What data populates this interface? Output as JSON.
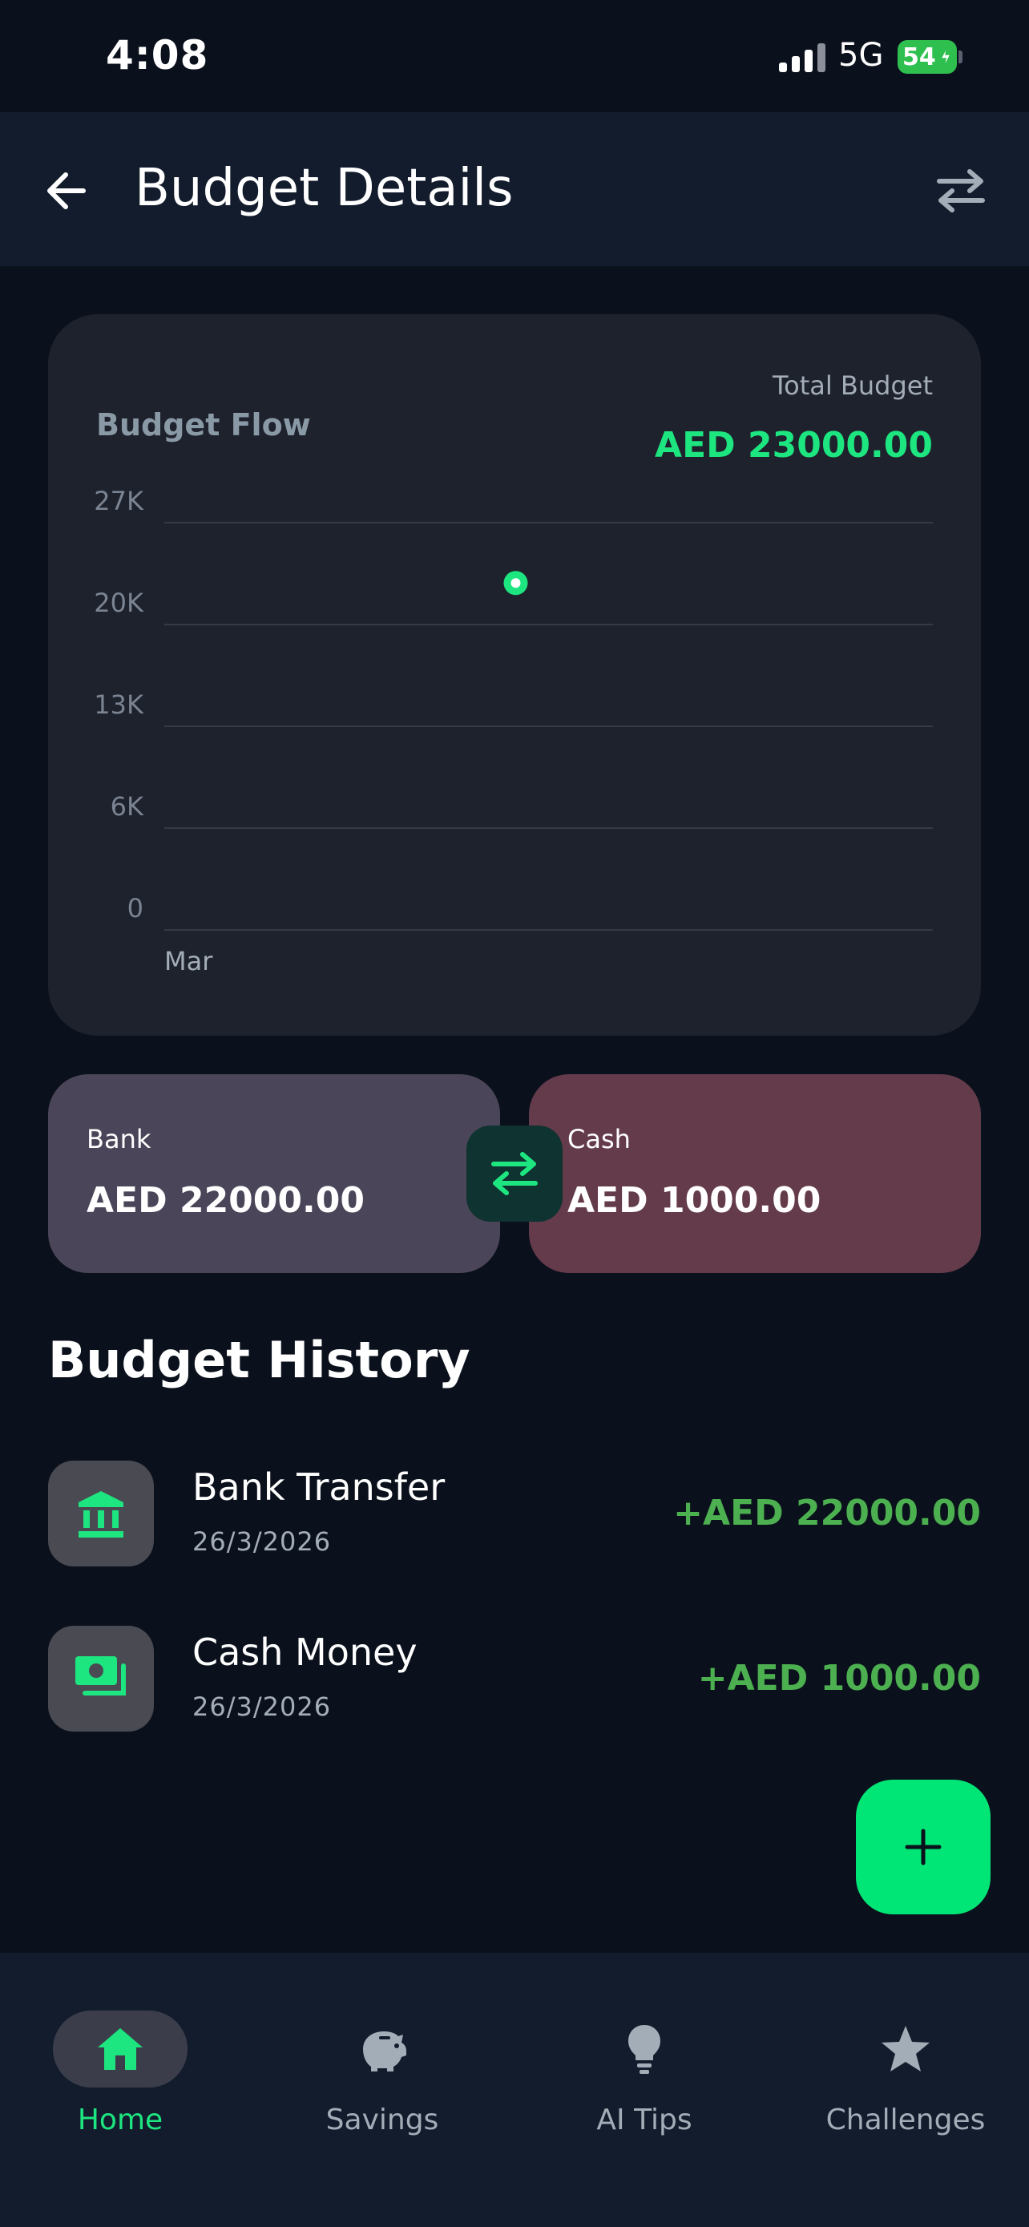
{
  "status_bar": {
    "time": "4:08",
    "network": "5G",
    "battery": "54"
  },
  "header": {
    "title": "Budget Details",
    "back_icon": "arrow-left-icon",
    "swap_icon": "swap-arrows-icon"
  },
  "summary": {
    "chart_title": "Budget Flow",
    "total_label": "Total Budget",
    "total_value": "AED 23000.00"
  },
  "chart_data": {
    "type": "line",
    "title": "Budget Flow",
    "categories": [
      "Mar"
    ],
    "series": [
      {
        "values": [
          23000
        ]
      }
    ],
    "y_ticks": [
      "0",
      "6K",
      "13K",
      "20K",
      "27K"
    ],
    "ylim": [
      0,
      27000
    ],
    "grid": true,
    "accent_color": "#1de57f"
  },
  "accounts": {
    "bank": {
      "label": "Bank",
      "value": "AED 22000.00"
    },
    "cash": {
      "label": "Cash",
      "value": "AED 1000.00"
    },
    "transfer_icon": "swap-arrows-icon"
  },
  "history": {
    "title": "Budget History",
    "items": [
      {
        "name": "Bank Transfer",
        "date": "26/3/2026",
        "amount": "+AED 22000.00",
        "icon": "bank-icon"
      },
      {
        "name": "Cash Money",
        "date": "26/3/2026",
        "amount": "+AED 1000.00",
        "icon": "cash-icon"
      }
    ]
  },
  "fab": {
    "icon": "plus-icon"
  },
  "nav": {
    "items": [
      {
        "label": "Home",
        "icon": "home-icon",
        "active": true
      },
      {
        "label": "Savings",
        "icon": "piggy-bank-icon",
        "active": false
      },
      {
        "label": "AI Tips",
        "icon": "lightbulb-icon",
        "active": false
      },
      {
        "label": "Challenges",
        "icon": "star-icon",
        "active": false
      }
    ]
  },
  "colors": {
    "background": "#0b111c",
    "surface": "#131c2d",
    "card": "#1e222d",
    "accent": "#1de57f",
    "positive": "#4caf50",
    "bank_card": "#4a4558",
    "cash_card": "#643b4b"
  }
}
